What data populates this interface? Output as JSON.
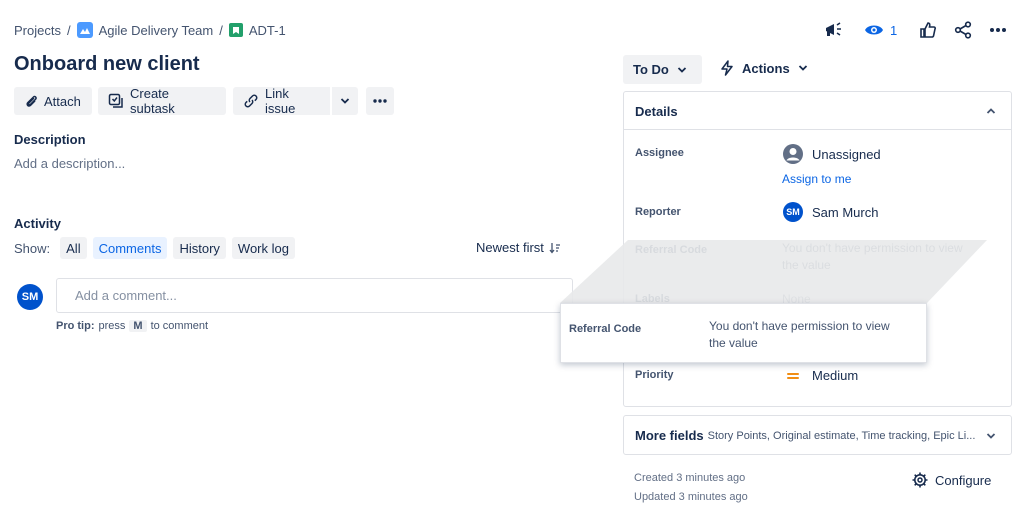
{
  "breadcrumb": {
    "projects": "Projects",
    "separator": "/",
    "team": "Agile Delivery Team",
    "issue_key": "ADT-1"
  },
  "header_actions": {
    "watchers_count": "1"
  },
  "issue": {
    "title": "Onboard new client"
  },
  "toolbar": {
    "attach": "Attach",
    "create_subtask": "Create subtask",
    "link_issue": "Link issue"
  },
  "description": {
    "heading": "Description",
    "placeholder": "Add a description..."
  },
  "activity": {
    "heading": "Activity",
    "show_label": "Show:",
    "tabs": [
      "All",
      "Comments",
      "History",
      "Work log"
    ],
    "sort_label": "Newest first",
    "comment_placeholder": "Add a comment...",
    "pro_tip_prefix": "Pro tip:",
    "pro_tip_press": "press",
    "pro_tip_key": "M",
    "pro_tip_suffix": "to comment",
    "avatar_initials": "SM"
  },
  "status": {
    "label": "To Do",
    "actions": "Actions"
  },
  "details": {
    "heading": "Details",
    "assignee_label": "Assignee",
    "assignee_value": "Unassigned",
    "assign_to_me": "Assign to me",
    "reporter_label": "Reporter",
    "reporter_initials": "SM",
    "reporter_value": "Sam Murch",
    "referral_label": "Referral Code",
    "referral_value": "You don't have permission to view the value",
    "labels_label": "Labels",
    "labels_value": "None",
    "priority_label": "Priority",
    "priority_value": "Medium"
  },
  "tooltip": {
    "label": "Referral Code",
    "value": "You don't have permission to view the value"
  },
  "more_fields": {
    "heading": "More fields",
    "summary": "Story Points, Original estimate, Time tracking, Epic Li..."
  },
  "footer": {
    "created": "Created 3 minutes ago",
    "updated": "Updated 3 minutes ago",
    "configure": "Configure"
  },
  "colors": {
    "accent": "#0c66e4",
    "avatar_bg": "#0052cc",
    "issue_type_green": "#22a06b",
    "priority_orange": "#f18d13"
  }
}
